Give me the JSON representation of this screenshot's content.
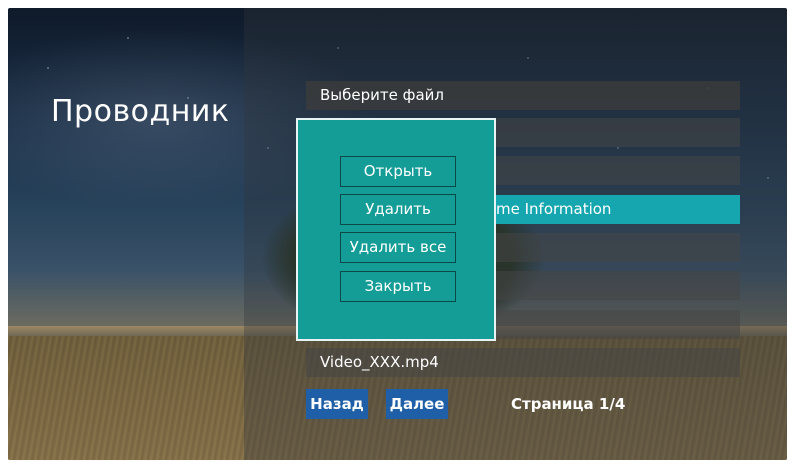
{
  "app": {
    "title": "Проводник"
  },
  "list": {
    "header": "Выберите файл",
    "rows": [
      "",
      "",
      "me Information",
      "",
      "",
      "",
      "Video_XXX.mp4"
    ]
  },
  "menu": {
    "open": "Открыть",
    "delete": "Удалить",
    "delete_all": "Удалить все",
    "close": "Закрыть"
  },
  "nav": {
    "back": "Назад",
    "next": "Далее",
    "page": "Страница 1/4"
  }
}
